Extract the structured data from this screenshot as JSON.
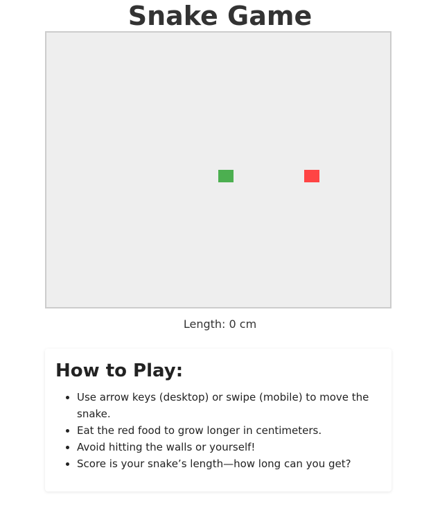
{
  "title": "Snake Game",
  "game": {
    "snake_color": "#4caf50",
    "food_color": "#ff4444",
    "board_color": "#eeeeee"
  },
  "status": {
    "length_text": "Length: 0 cm"
  },
  "instructions": {
    "heading": "How to Play:",
    "items": [
      "Use arrow keys (desktop) or swipe (mobile) to move the snake.",
      "Eat the red food to grow longer in centimeters.",
      "Avoid hitting the walls or yourself!",
      "Score is your snake’s length—how long can you get?"
    ]
  }
}
